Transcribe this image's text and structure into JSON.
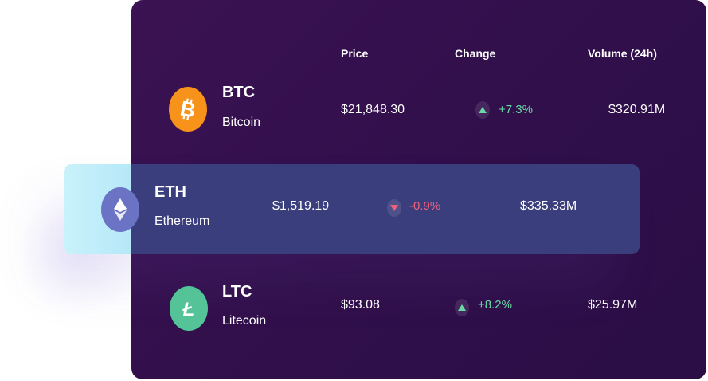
{
  "header": {
    "price_label": "Price",
    "change_label": "Change",
    "volume_label": "Volume (24h)"
  },
  "rows": [
    {
      "ticker": "BTC",
      "name": "Bitcoin",
      "price": "$21,848.30",
      "change": "+7.3%",
      "direction": "up",
      "volume": "$320.91M",
      "icon": "bitcoin-icon",
      "icon_color": "#f7931a"
    },
    {
      "ticker": "ETH",
      "name": "Ethereum",
      "price": "$1,519.19",
      "change": "-0.9%",
      "direction": "down",
      "volume": "$335.33M",
      "icon": "ethereum-icon",
      "icon_color": "#6b74c4"
    },
    {
      "ticker": "LTC",
      "name": "Litecoin",
      "price": "$93.08",
      "change": "+8.2%",
      "direction": "up",
      "volume": "$25.97M",
      "icon": "litecoin-icon",
      "icon_color": "#54c398"
    }
  ],
  "colors": {
    "panel_bg": "#36104f",
    "highlight_row_bg": "#3a3e7d",
    "highlight_accent": "#c9f2fb",
    "positive": "#69d9a6",
    "negative": "#f0607c"
  }
}
